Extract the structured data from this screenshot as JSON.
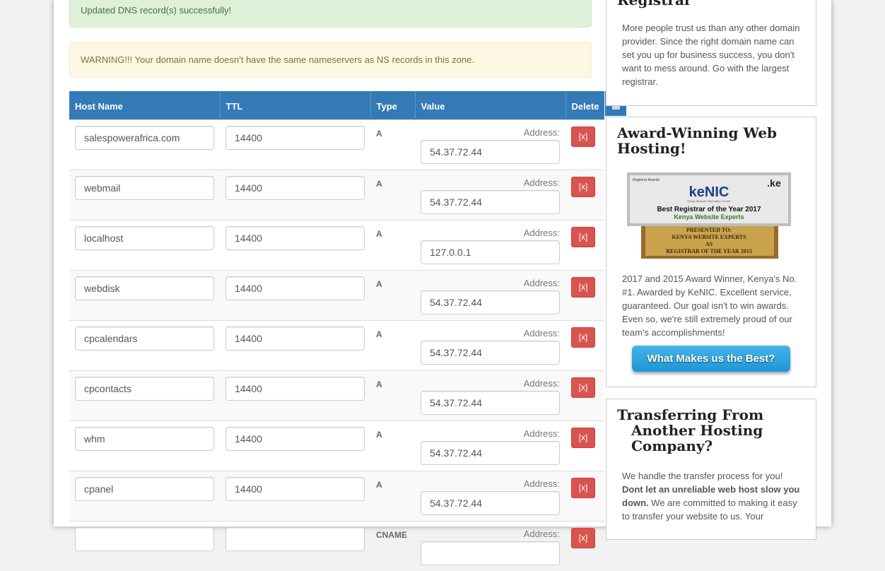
{
  "alerts": {
    "success": "Updated DNS record(s) successfully!",
    "warning": "WARNING!!! Your domain name doesn't have the same nameservers as NS records in this zone."
  },
  "table": {
    "headers": {
      "host": "Host Name",
      "ttl": "TTL",
      "type": "Type",
      "value": "Value",
      "delete": "Delete"
    },
    "address_label": "Address:",
    "delete_label": "[x]",
    "rows": [
      {
        "host": "salespowerafrica.com",
        "ttl": "14400",
        "type": "A",
        "value": "54.37.72.44"
      },
      {
        "host": "webmail",
        "ttl": "14400",
        "type": "A",
        "value": "54.37.72.44"
      },
      {
        "host": "localhost",
        "ttl": "14400",
        "type": "A",
        "value": "127.0.0.1"
      },
      {
        "host": "webdisk",
        "ttl": "14400",
        "type": "A",
        "value": "54.37.72.44"
      },
      {
        "host": "cpcalendars",
        "ttl": "14400",
        "type": "A",
        "value": "54.37.72.44"
      },
      {
        "host": "cpcontacts",
        "ttl": "14400",
        "type": "A",
        "value": "54.37.72.44"
      },
      {
        "host": "whm",
        "ttl": "14400",
        "type": "A",
        "value": "54.37.72.44"
      },
      {
        "host": "cpanel",
        "ttl": "14400",
        "type": "A",
        "value": "54.37.72.44"
      },
      {
        "host": "",
        "ttl": "",
        "type": "CNAME",
        "value": ""
      }
    ]
  },
  "sidebar": {
    "registrar": {
      "title": "Registrar",
      "text": "More people trust us than any other domain provider. Since the right domain name can set you up for business success, you don't want to mess around. Go with the largest registrar."
    },
    "award": {
      "title": "Award-Winning Web Hosting!",
      "image_lettering": {
        "top_left": "Registrar Awards",
        "brand": "KENIC",
        "domain": ".ke",
        "subtitle": "Kenya Network Information Center",
        "headline": "Best Registrar of the Year 2017",
        "company": "Kenya Website Experts",
        "presented": "PRESENTED TO:",
        "presented_to": "KENYA WEBSITE EXPERTS",
        "as": "AS",
        "award_2015": "REGISTRAR OF THE YEAR 2015"
      },
      "text": "2017 and 2015 Award Winner, Kenya's No. #1. Awarded by KeNIC. Excellent service, guaranteed. Our goal isn't to win awards. Even so, we're still extremely proud of our team's accomplishments!",
      "button": "What Makes us the Best?"
    },
    "transfer": {
      "title_line1": "Transferring From",
      "title_line2": "Another Hosting",
      "title_line3": "Company?",
      "text_intro": "We handle the transfer process for you!",
      "text_bold": "Dont let an unreliable web host slow you down.",
      "text_rest": "We are committed to making it easy to transfer your website to us. Your"
    }
  },
  "colors": {
    "header_blue": "#337ab7",
    "danger_red": "#d9534f",
    "success_bg": "#dff0d8",
    "warning_bg": "#fcf8e3",
    "cta_blue": "#2aa4e0"
  }
}
